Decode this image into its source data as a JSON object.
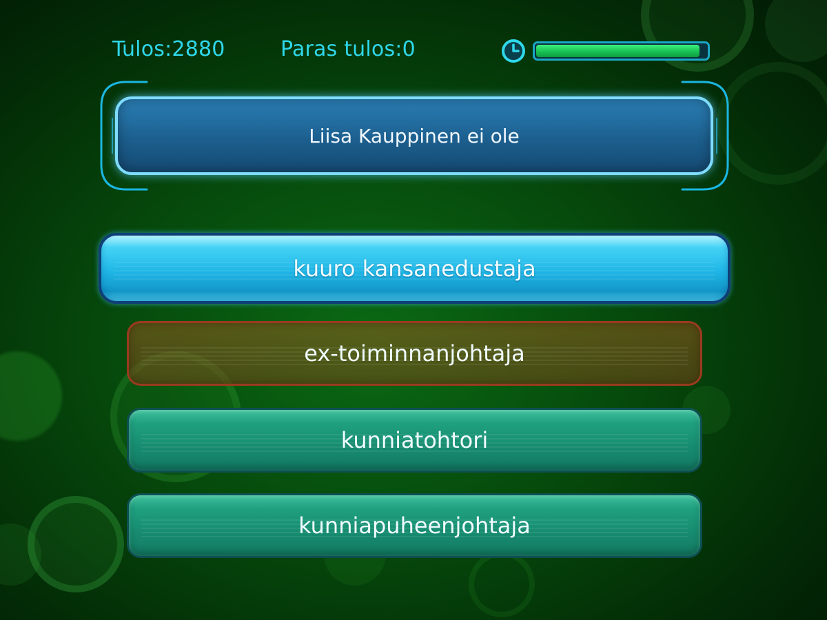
{
  "header": {
    "score_label": "Tulos:",
    "score_value": "2880",
    "best_label": "Paras tulos:",
    "best_value": "0",
    "timer_icon": "clock-icon",
    "timer_remaining_fraction": 0.96
  },
  "question": {
    "text": "Liisa Kauppinen ei ole"
  },
  "answers": [
    {
      "label": "kuuro kansanedustaja",
      "state": "selected"
    },
    {
      "label": "ex-toiminnanjohtaja",
      "state": "wrong"
    },
    {
      "label": "kunniatohtori",
      "state": "normal"
    },
    {
      "label": "kunniapuheenjohtaja",
      "state": "normal"
    }
  ],
  "colors": {
    "accent_text": "#2fd7ea",
    "timer_fill": "#18c253",
    "selected_answer": "#1fb6e6",
    "wrong_answer": "#9a3a1f",
    "normal_answer": "#1fa07f",
    "background": "#064a0c"
  }
}
